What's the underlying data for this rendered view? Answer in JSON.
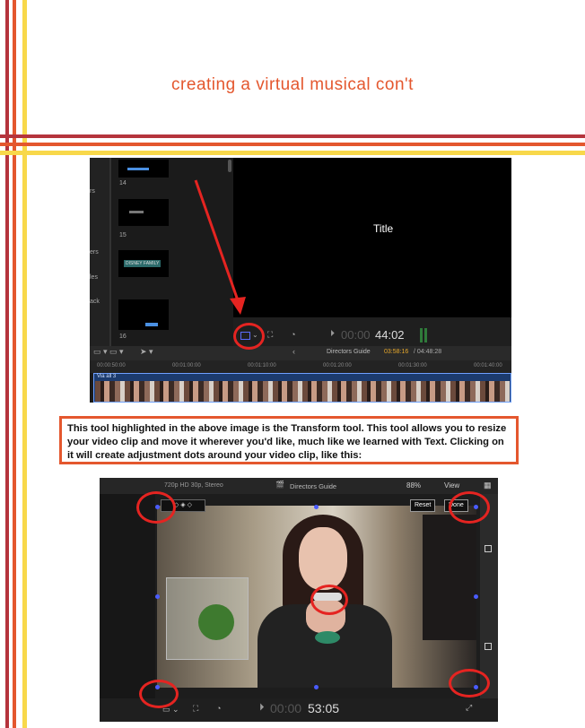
{
  "colors": {
    "accent": "#e4572e",
    "dark_red": "#b5343c",
    "yellow": "#f8d84a",
    "highlight": "#e52421"
  },
  "page": {
    "title": "creating a virtual musical con't"
  },
  "screenshot1": {
    "viewer_title": "Title",
    "sidebar_fragments": [
      "rs",
      "ers",
      "les",
      "ack"
    ],
    "thumb_numbers": [
      "14",
      "15",
      "16"
    ],
    "timecode_dim": "00:00",
    "timecode": "44:02",
    "project_name": "Directors Guide",
    "duration_current": "03:58:16",
    "duration_total": "/ 04:48:28",
    "ruler": [
      "00:00:50:00",
      "00:01:00:00",
      "00:01:10:00",
      "00:01:20:00",
      "00:01:30:00",
      "00:01:40:00"
    ],
    "clip_label": "Via all 3",
    "thumb_caption": "DISNEY FAMILY"
  },
  "callout": {
    "text": "This tool highlighted in the above image is the Transform tool. This tool allows you to resize your video clip and move it wherever you'd like, much like we learned with Text. Clicking on it will create adjustment dots around your video clip, like this:"
  },
  "screenshot2": {
    "format": "720p HD 30p, Stereo",
    "project_name": "Directors Guide",
    "zoom": "88%",
    "view_label": "View",
    "reset_label": "Reset",
    "done_label": "Done",
    "timecode_dim": "00:00",
    "timecode": "53:05"
  }
}
